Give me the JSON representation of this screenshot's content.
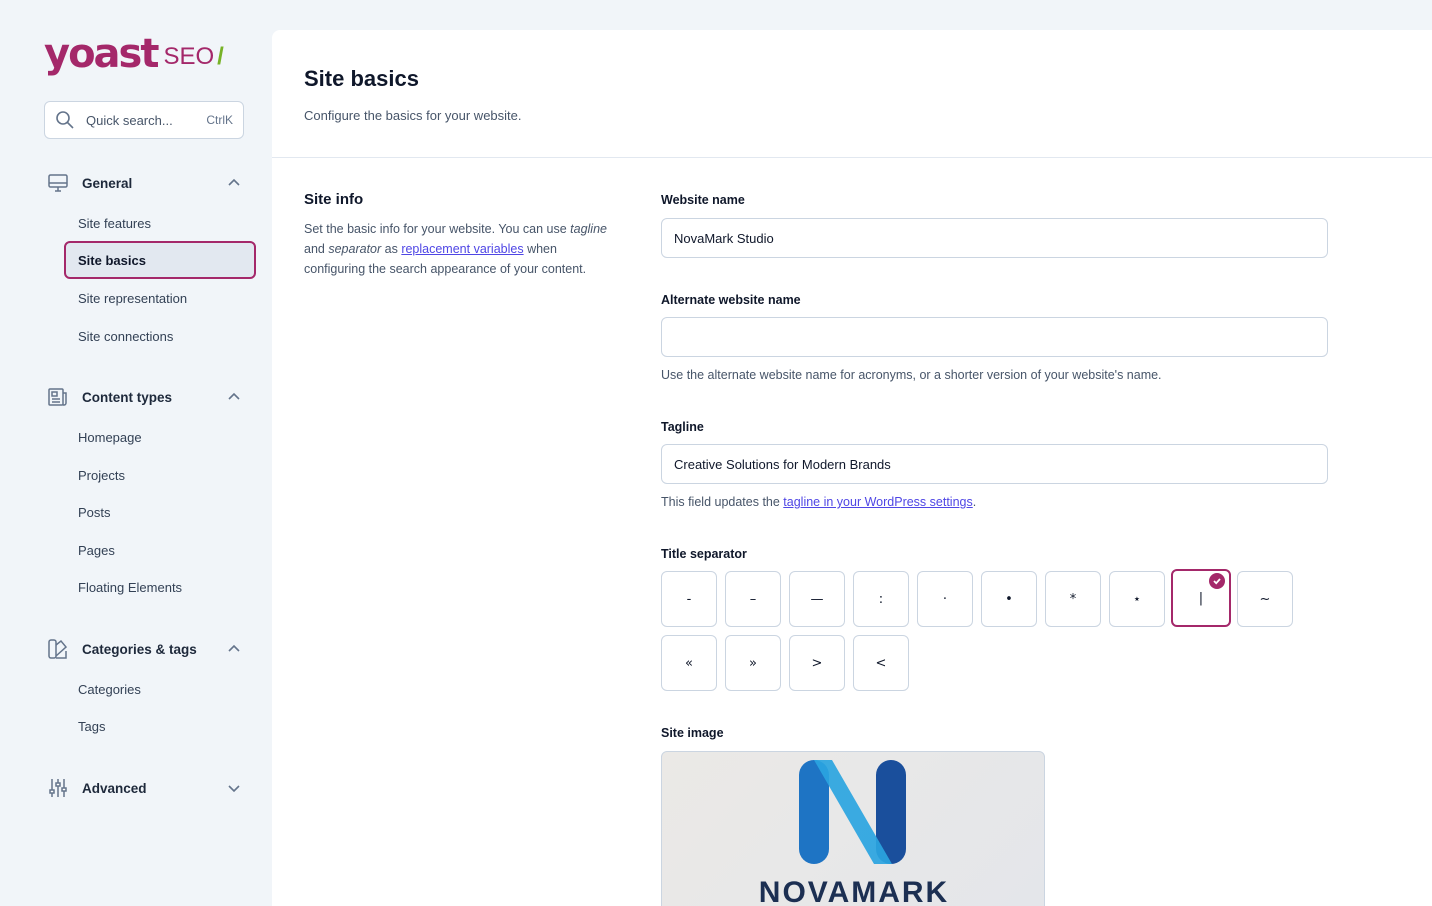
{
  "logo": {
    "brand": "yoast",
    "product": "SEO",
    "slash": "/"
  },
  "search": {
    "placeholder": "Quick search...",
    "shortcut": "CtrlK"
  },
  "sidebar": {
    "groups": [
      {
        "label": "General",
        "icon": "monitor-icon",
        "expanded": true,
        "items": [
          "Site features",
          "Site basics",
          "Site representation",
          "Site connections"
        ]
      },
      {
        "label": "Content types",
        "icon": "newspaper-icon",
        "expanded": true,
        "items": [
          "Homepage",
          "Projects",
          "Posts",
          "Pages",
          "Floating Elements"
        ]
      },
      {
        "label": "Categories & tags",
        "icon": "color-swatch-icon",
        "expanded": true,
        "items": [
          "Categories",
          "Tags"
        ]
      },
      {
        "label": "Advanced",
        "icon": "adjustments-icon",
        "expanded": false,
        "items": []
      }
    ],
    "active_item": "Site basics"
  },
  "page": {
    "title": "Site basics",
    "description": "Configure the basics for your website."
  },
  "site_info": {
    "title": "Site info",
    "desc_part1": "Set the basic info for your website. You can use ",
    "desc_tagline": "tagline",
    "desc_and": " and ",
    "desc_separator": "separator",
    "desc_as": " as ",
    "desc_link": "replacement variables",
    "desc_part2": " when configuring the search appearance of your content."
  },
  "fields": {
    "website_name": {
      "label": "Website name",
      "value": "NovaMark Studio"
    },
    "alternate_name": {
      "label": "Alternate website name",
      "value": "",
      "help": "Use the alternate website name for acronyms, or a shorter version of your website's name."
    },
    "tagline": {
      "label": "Tagline",
      "value": "Creative Solutions for Modern Brands",
      "help_prefix": "This field updates the ",
      "help_link": "tagline in your WordPress settings",
      "help_suffix": "."
    },
    "title_separator": {
      "label": "Title separator",
      "options": [
        "-",
        "–",
        "—",
        ":",
        "·",
        "•",
        "*",
        "⋆",
        "|",
        "~",
        "«",
        "»",
        ">",
        "<"
      ],
      "selected": "|"
    },
    "site_image": {
      "label": "Site image",
      "brand_text": "NOVAMARK"
    }
  },
  "colors": {
    "accent": "#a4286a",
    "logo_green": "#77b227",
    "link": "#4f46e5"
  }
}
